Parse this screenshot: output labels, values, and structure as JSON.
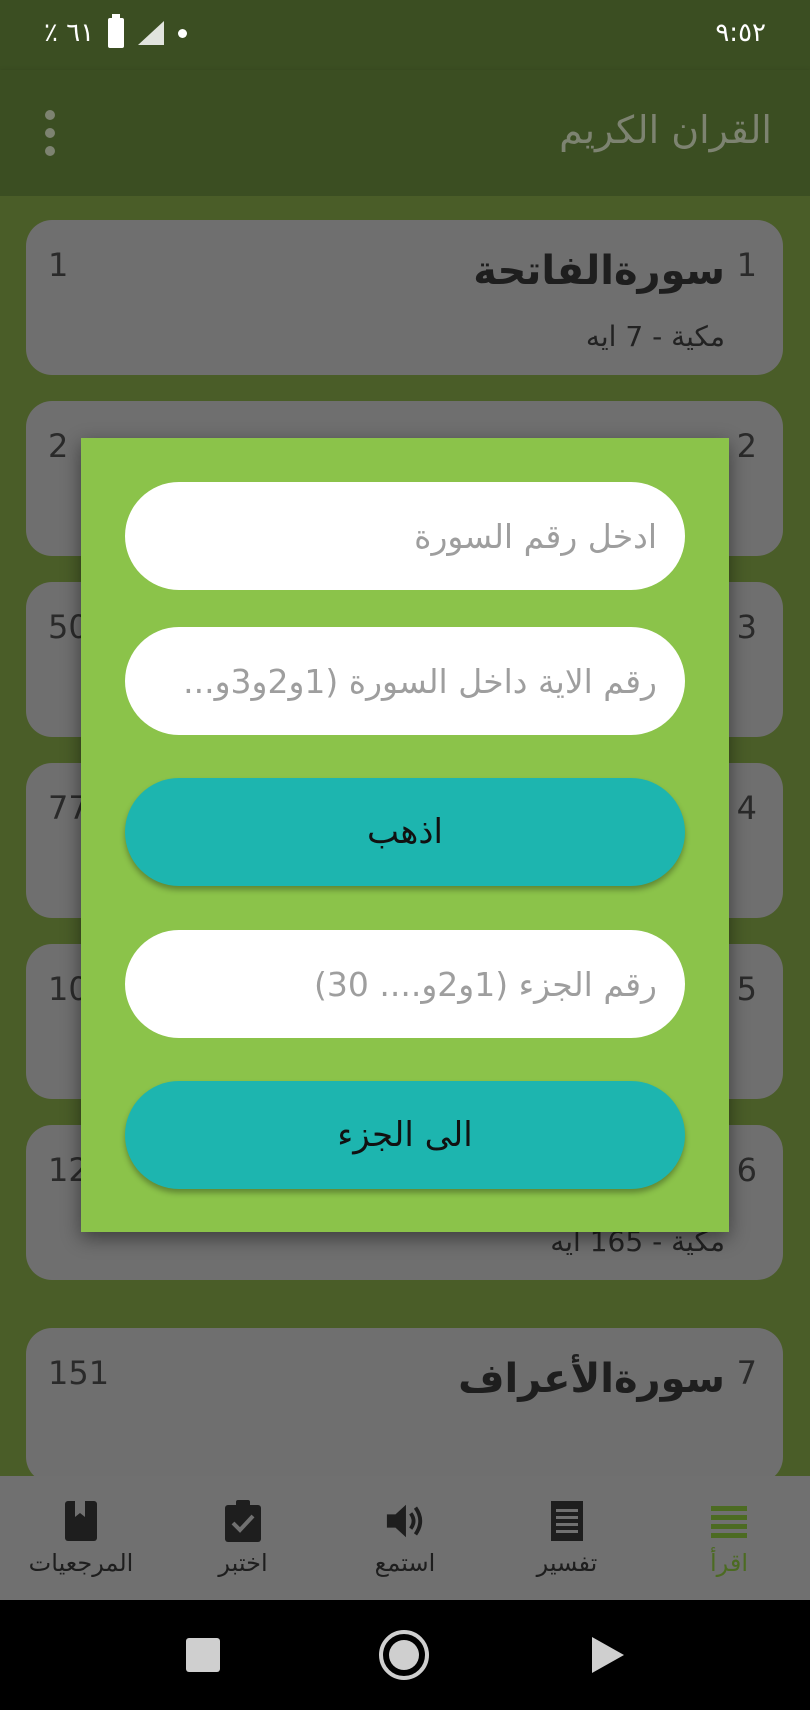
{
  "status_bar": {
    "time": "٩:٥٢",
    "battery": "٪ ٦١"
  },
  "app_bar": {
    "title": "القران الكريم"
  },
  "surahs": [
    {
      "number": "1",
      "name": "سورةالفاتحة",
      "type": "مكية",
      "ayat": "7 ايه",
      "page": "1"
    },
    {
      "number": "2",
      "name": "",
      "type": "",
      "ayat": "",
      "page": "2"
    },
    {
      "number": "3",
      "name": "",
      "type": "",
      "ayat": "",
      "page": "50"
    },
    {
      "number": "4",
      "name": "",
      "type": "",
      "ayat": "",
      "page": "77"
    },
    {
      "number": "5",
      "name": "",
      "type": "",
      "ayat": "",
      "page": "10"
    },
    {
      "number": "6",
      "name": "",
      "type": "مكية",
      "ayat": "165 ايه",
      "page": "12"
    },
    {
      "number": "7",
      "name": "سورةالأعراف",
      "type": "",
      "ayat": "",
      "page": "151"
    }
  ],
  "dialog": {
    "surah_input_placeholder": "ادخل رقم السورة",
    "ayah_input_placeholder": "رقم الاية داخل السورة (1و2و3و...",
    "go_button": "اذهب",
    "juz_input_placeholder": "رقم الجزء (1و2و.... 30)",
    "juz_button": "الى الجزء"
  },
  "bottom_nav": [
    {
      "label": "اقرأ",
      "icon": "menu-lines-icon",
      "active": true
    },
    {
      "label": "تفسير",
      "icon": "notes-icon",
      "active": false
    },
    {
      "label": "استمع",
      "icon": "speaker-icon",
      "active": false
    },
    {
      "label": "اختبر",
      "icon": "clipboard-check-icon",
      "active": false
    },
    {
      "label": "المرجعيات",
      "icon": "bookmark-book-icon",
      "active": false
    }
  ],
  "colors": {
    "dialog_bg": "#8bc34a",
    "button_bg": "#1db5af",
    "active_nav": "#4c6b22"
  }
}
